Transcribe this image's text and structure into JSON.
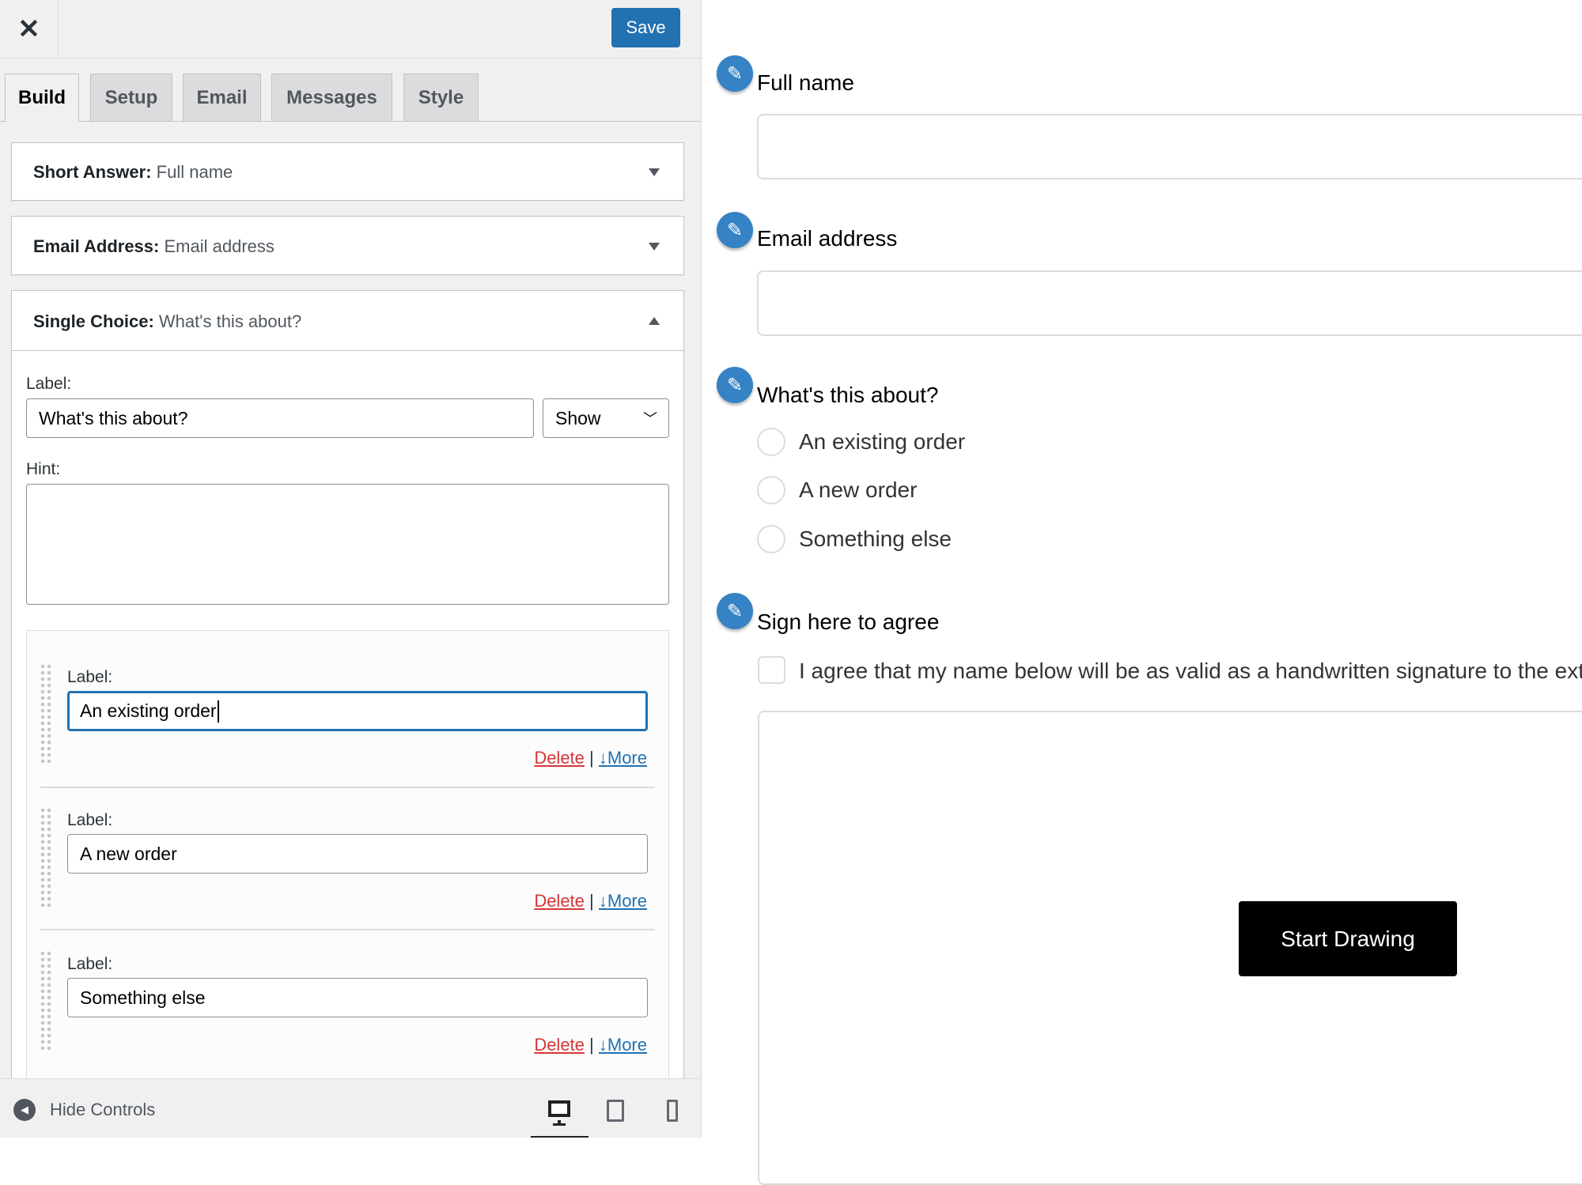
{
  "toolbar": {
    "close_icon": "close-icon",
    "save_label": "Save",
    "accent": "#2271b1"
  },
  "tabs": [
    {
      "label": "Build",
      "active": true
    },
    {
      "label": "Setup"
    },
    {
      "label": "Email"
    },
    {
      "label": "Messages"
    },
    {
      "label": "Style"
    }
  ],
  "fields": [
    {
      "type": "Short Answer:",
      "name": "Full name",
      "expanded": false
    },
    {
      "type": "Email Address:",
      "name": "Email address",
      "expanded": false
    },
    {
      "type": "Single Choice:",
      "name": "What's this about?",
      "expanded": true
    }
  ],
  "editor": {
    "label_caption": "Label:",
    "label_value": "What's this about?",
    "visibility_select": "Show",
    "hint_caption": "Hint:",
    "hint_value": "",
    "options": [
      {
        "caption": "Label:",
        "value": "An existing order",
        "focused": true
      },
      {
        "caption": "Label:",
        "value": "A new order"
      },
      {
        "caption": "Label:",
        "value": "Something else"
      }
    ],
    "delete_label": "Delete",
    "separator": "|",
    "more_label": "More",
    "delete_color": "#d63638"
  },
  "bottom": {
    "hide_controls": "Hide Controls",
    "devices": [
      "desktop-icon",
      "tablet-icon",
      "mobile-icon"
    ],
    "active_device": "desktop"
  },
  "preview": {
    "full_name_label": "Full name",
    "email_label": "Email address",
    "choice_label": "What's this about?",
    "choices": [
      "An existing order",
      "A new order",
      "Something else"
    ],
    "sign_label": "Sign here to agree",
    "agree_text": "I agree that my name below will be as valid as a handwritten signature to the ext",
    "start_drawing": "Start Drawing"
  }
}
